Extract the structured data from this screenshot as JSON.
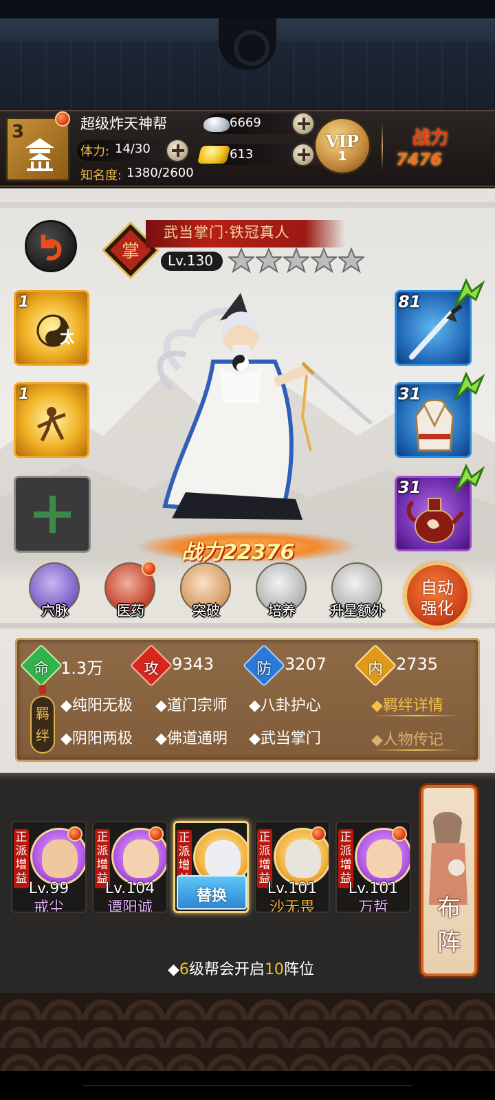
{
  "header": {
    "guild_level": "3",
    "guild_name": "超级炸天神帮",
    "stamina_label": "体力:",
    "stamina_value": "14/30",
    "fame_label": "知名度:",
    "fame_value": "1380/2600",
    "silver": "6669",
    "gold": "613",
    "vip_text": "VIP",
    "vip_level": "1",
    "power_label": "战力",
    "power_value": "7476"
  },
  "hero": {
    "title": "武当掌门·铁冠真人",
    "level": "Lv.130",
    "stars": 5,
    "power": "战力22376"
  },
  "skills": [
    {
      "count": "1",
      "icon": "taiji-scroll-icon"
    },
    {
      "count": "1",
      "icon": "sword-stance-icon"
    }
  ],
  "equipment": [
    {
      "level": "81",
      "icon": "sword-icon",
      "rarity": "blue"
    },
    {
      "level": "31",
      "icon": "robe-icon",
      "rarity": "blue"
    },
    {
      "level": "31",
      "icon": "teapot-icon",
      "rarity": "purple"
    }
  ],
  "actions": [
    {
      "label": "穴脉",
      "icon": "meridian-icon"
    },
    {
      "label": "医药",
      "icon": "medicine-icon"
    },
    {
      "label": "突破",
      "icon": "breakthrough-icon"
    },
    {
      "label": "培养",
      "icon": "cultivate-icon"
    },
    {
      "label": "升星额外",
      "icon": "star-up-icon"
    }
  ],
  "auto_strengthen": {
    "line1": "自动",
    "line2": "强化"
  },
  "stats": [
    {
      "key": "命",
      "value": "1.3万",
      "color": "#2fb34a"
    },
    {
      "key": "攻",
      "value": "9343",
      "color": "#d8261c"
    },
    {
      "key": "防",
      "value": "3207",
      "color": "#2a78d8"
    },
    {
      "key": "内",
      "value": "2735",
      "color": "#e09a18"
    }
  ],
  "bonds": {
    "tag": "羁绊",
    "items": [
      "纯阳无极",
      "道门宗师",
      "八卦护心",
      "阴阳两极",
      "佛道通明",
      "武当掌门"
    ],
    "details_link": "◆羁绊详情",
    "biography_link": "◆人物传记"
  },
  "lineup": {
    "faction_label": "正派增益",
    "members": [
      {
        "level": "Lv.99",
        "name": "戒尘",
        "name_color": "purple"
      },
      {
        "level": "Lv.104",
        "name": "谭阳诚",
        "name_color": "purple"
      },
      {
        "level": "",
        "name": "",
        "selected": true,
        "button": "替换"
      },
      {
        "level": "Lv.101",
        "name": "沙无畏",
        "name_color": "orange"
      },
      {
        "level": "Lv.101",
        "name": "万哲",
        "name_color": "purple"
      }
    ],
    "formation_button": "布阵",
    "unlock_tip": {
      "prefix": "◆",
      "level": "6",
      "middle": "级帮会开启",
      "slots": "10",
      "suffix": "阵位"
    }
  },
  "colors": {
    "accent_gold": "#f0b847",
    "power_red": "#e43d15",
    "replace_blue": "#2e86d4"
  }
}
